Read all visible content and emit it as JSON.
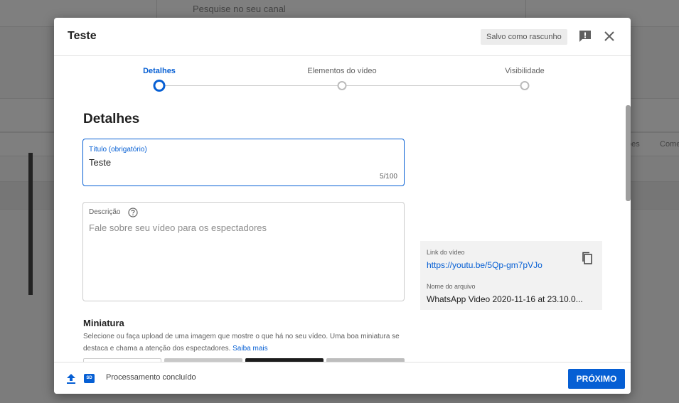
{
  "background": {
    "search_placeholder": "Pesquise no seu canal",
    "columns": [
      "ões",
      "Come"
    ]
  },
  "dialog": {
    "title": "Teste",
    "draft_badge": "Salvo como rascunho",
    "icons": {
      "feedback": "feedback-icon",
      "close": "close-icon"
    }
  },
  "stepper": {
    "steps": [
      {
        "label": "Detalhes",
        "active": true
      },
      {
        "label": "Elementos do vídeo",
        "active": false
      },
      {
        "label": "Visibilidade",
        "active": false
      }
    ]
  },
  "details": {
    "section_title": "Detalhes",
    "title_field": {
      "label": "Título (obrigatório)",
      "value": "Teste",
      "counter": "5/100"
    },
    "description_field": {
      "label": "Descrição",
      "placeholder": "Fale sobre seu vídeo para os espectadores"
    },
    "video_info": {
      "link_label": "Link do vídeo",
      "link": "https://youtu.be/5Qp-gm7pVJo",
      "file_label": "Nome do arquivo",
      "file_name": "WhatsApp Video 2020-11-16 at 23.10.0..."
    },
    "thumbnail": {
      "title": "Miniatura",
      "description": "Selecione ou faça upload de uma imagem que mostre o que há no seu vídeo. Uma boa miniatura se destaca e chama a atenção dos espectadores.",
      "learn_more": "Saiba mais"
    }
  },
  "footer": {
    "quality_badge": "SD",
    "status": "Processamento concluído",
    "next_button": "PRÓXIMO"
  },
  "colors": {
    "accent": "#065fd4",
    "overlay": "rgba(0,0,0,0.5)"
  }
}
